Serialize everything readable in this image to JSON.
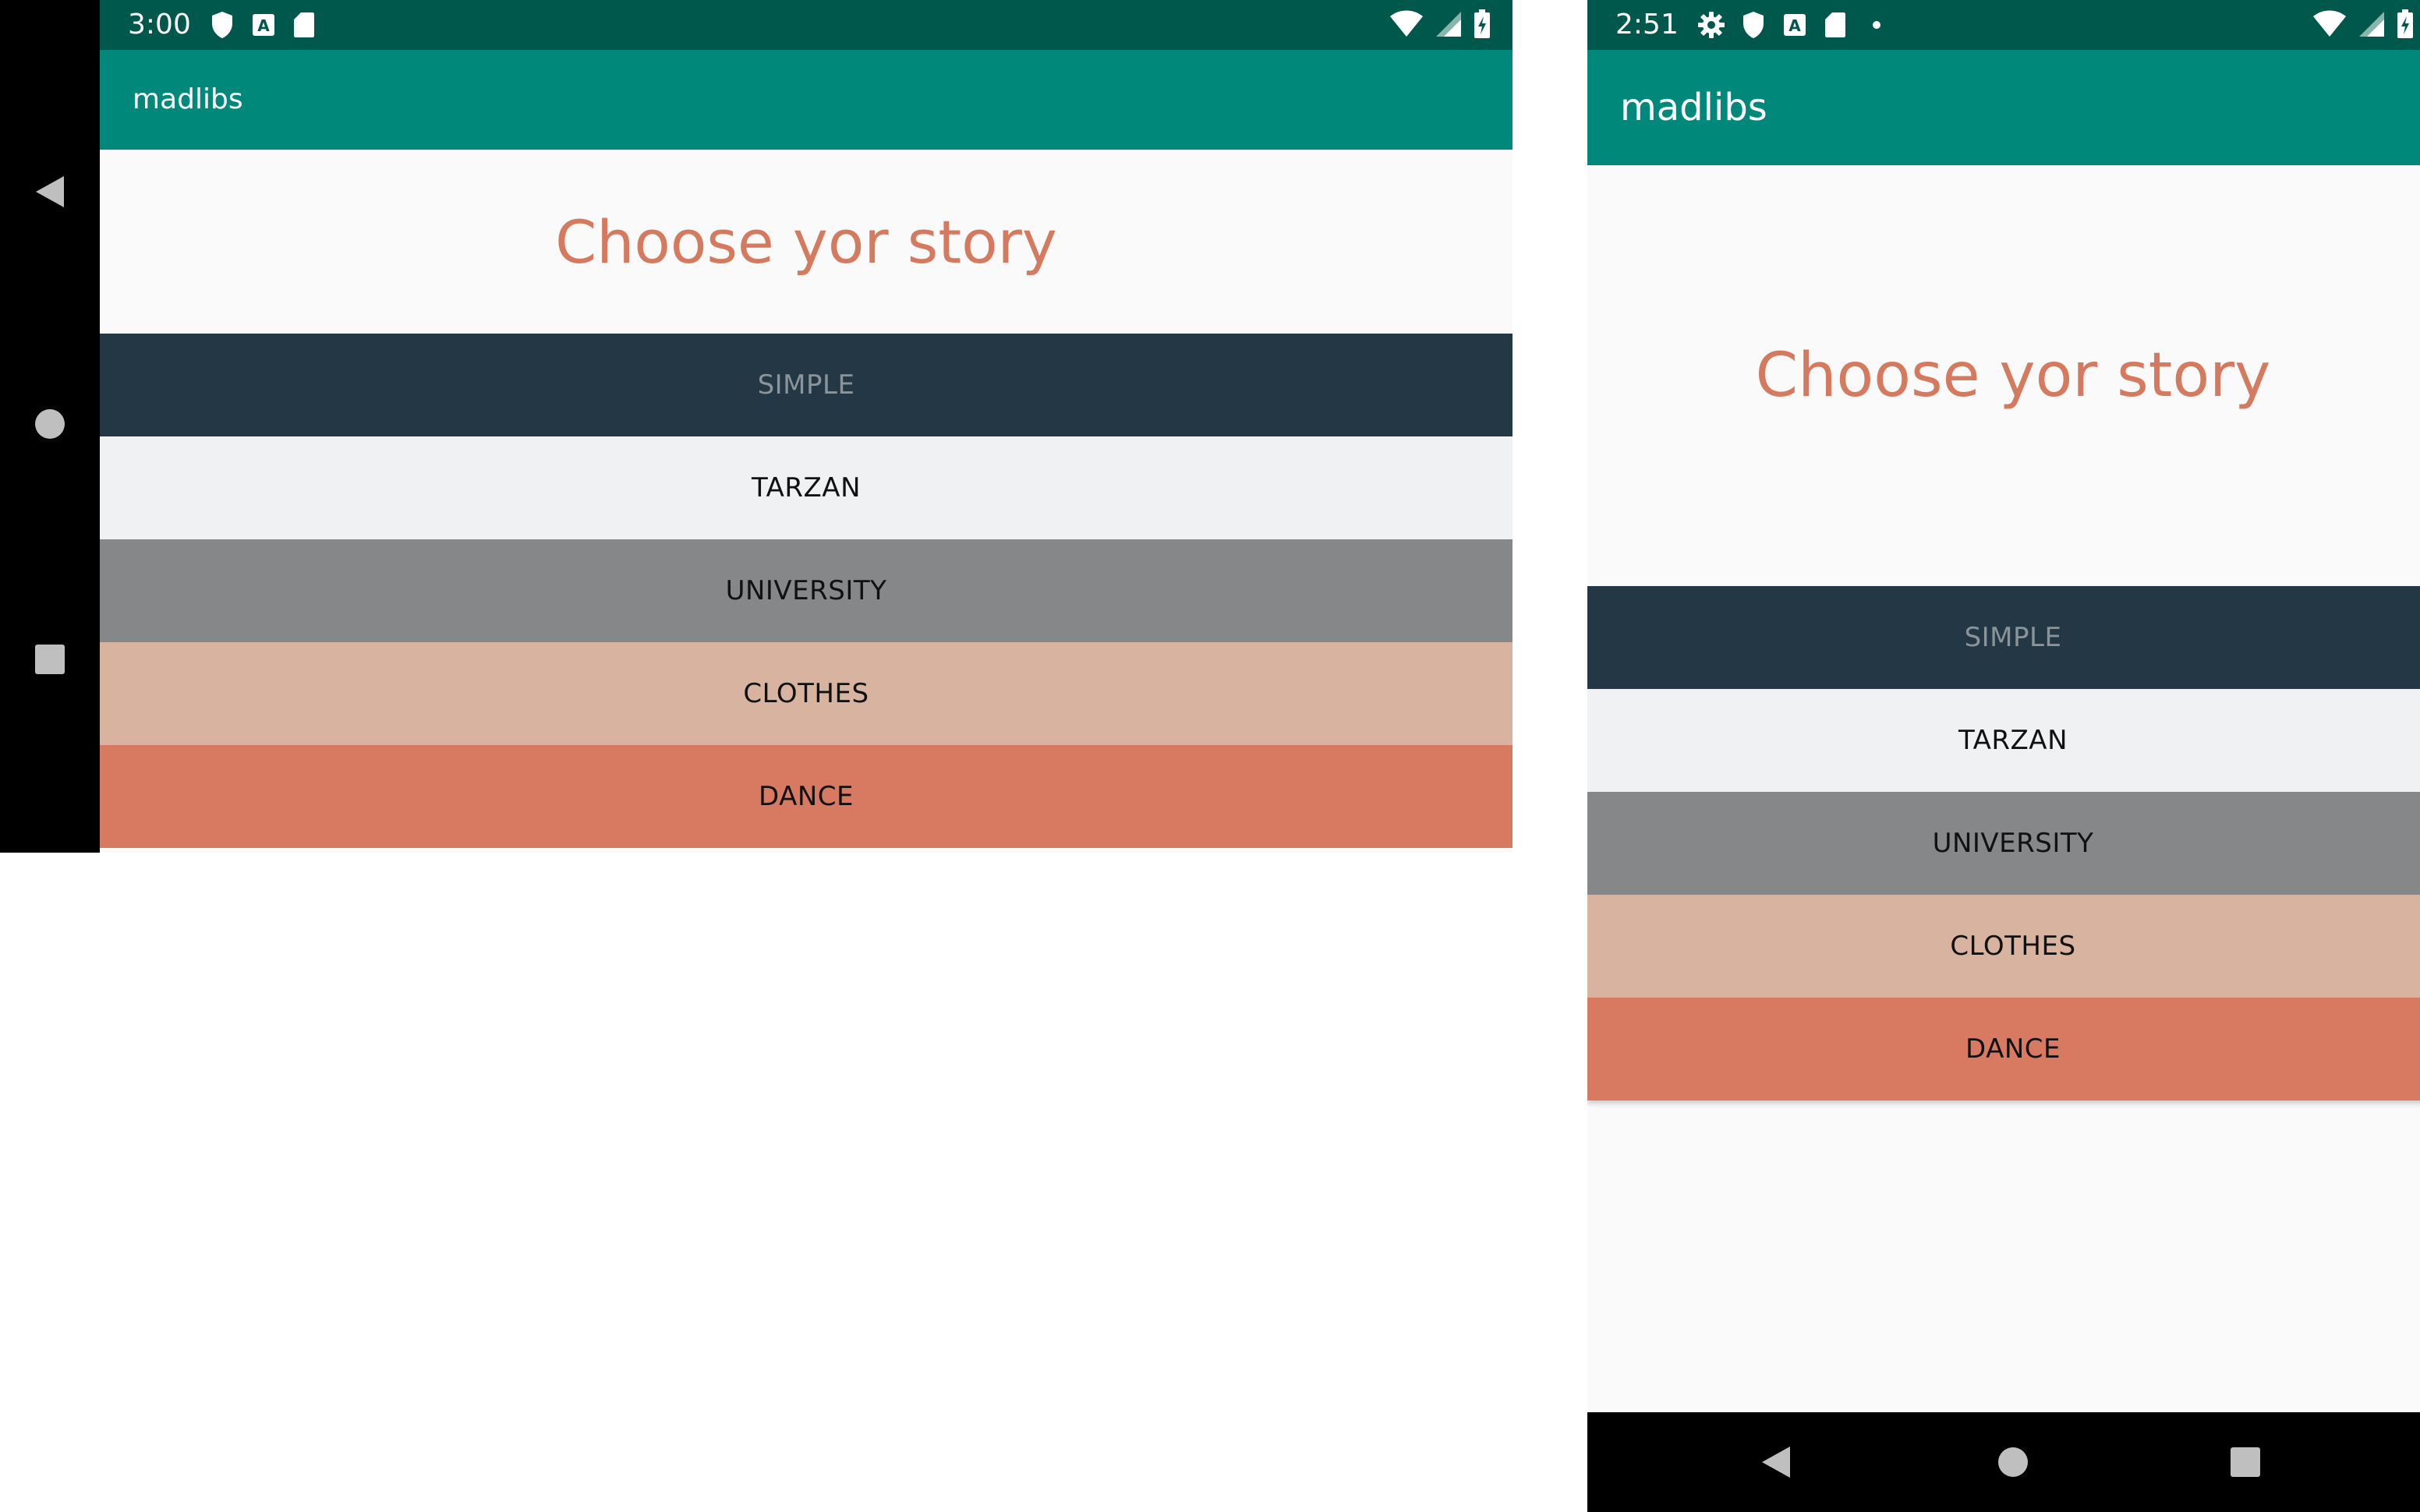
{
  "colors": {
    "status_bar": "#00574b",
    "app_bar": "#00897b",
    "heading": "#d57a5f",
    "background": "#fafafa"
  },
  "landscape": {
    "status": {
      "time": "3:00",
      "icons_left": [
        "shield-icon",
        "a-box-icon",
        "sd-card-icon"
      ],
      "icons_right": [
        "wifi-icon",
        "signal-icon",
        "battery-charging-icon"
      ]
    },
    "app_title": "madlibs",
    "heading": "Choose yor story",
    "nav_icons": [
      "back-icon",
      "home-icon",
      "recents-icon"
    ]
  },
  "portrait": {
    "status": {
      "time": "2:51",
      "icons_left": [
        "gear-icon",
        "shield-icon",
        "a-box-icon",
        "sd-card-icon",
        "dot-icon"
      ],
      "icons_right": [
        "wifi-icon",
        "signal-icon",
        "battery-charging-icon"
      ]
    },
    "app_title": "madlibs",
    "heading": "Choose yor story",
    "nav_icons": [
      "back-icon",
      "home-icon",
      "recents-icon"
    ]
  },
  "stories": [
    {
      "label": "SIMPLE",
      "bg": "#233745",
      "fg": "#8a949a"
    },
    {
      "label": "TARZAN",
      "bg": "#f0f1f3",
      "fg": "#111111"
    },
    {
      "label": "UNIVERSITY",
      "bg": "#868789",
      "fg": "#111111"
    },
    {
      "label": "CLOTHES",
      "bg": "#d8b4a0",
      "fg": "#111111"
    },
    {
      "label": "DANCE",
      "bg": "#d87a62",
      "fg": "#111111"
    }
  ]
}
